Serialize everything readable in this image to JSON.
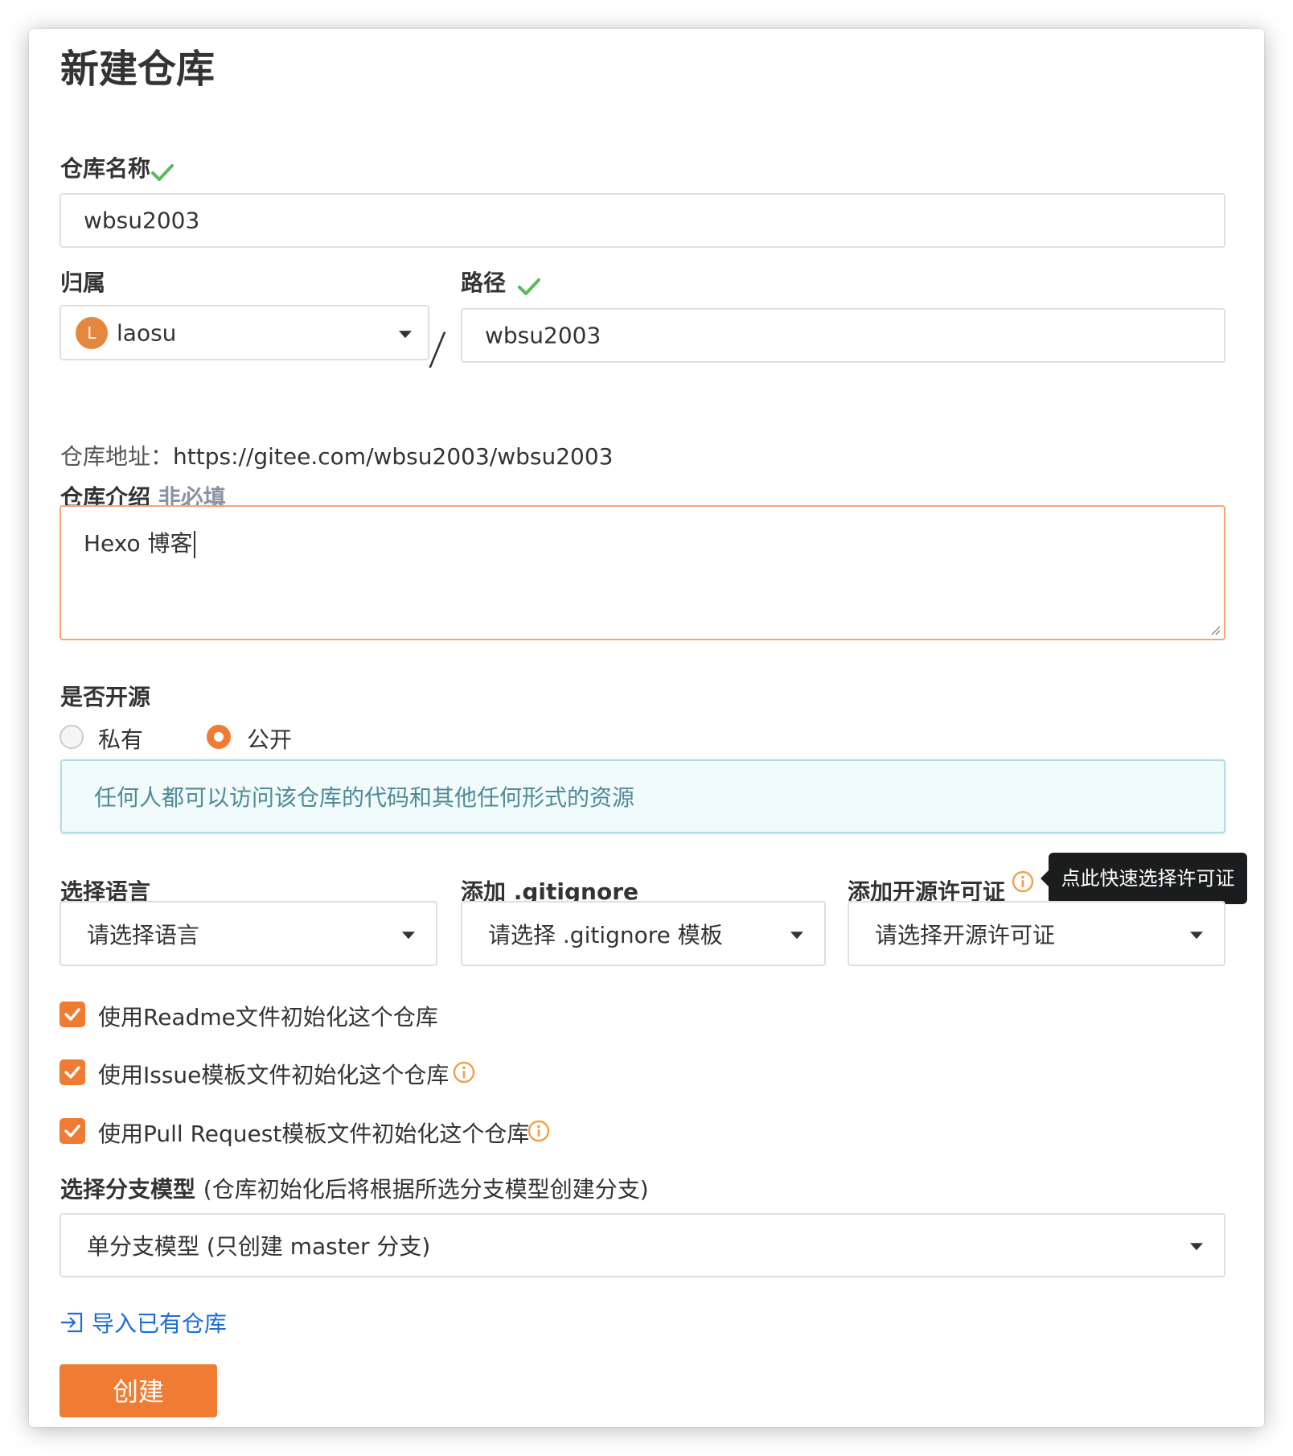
{
  "page": {
    "title": "新建仓库"
  },
  "repo_name": {
    "label": "仓库名称",
    "value": "wbsu2003"
  },
  "owner": {
    "label": "归属",
    "avatar_letter": "L",
    "value": "laosu"
  },
  "path": {
    "label": "路径",
    "value": "wbsu2003"
  },
  "separator": "/",
  "address": {
    "prefix": "仓库地址：",
    "url": "https://gitee.com/wbsu2003/wbsu2003"
  },
  "description": {
    "label": "仓库介绍",
    "optional_hint": "非必填",
    "value": "Hexo 博客"
  },
  "visibility": {
    "label": "是否开源",
    "options": [
      "私有",
      "公开"
    ],
    "selected": "公开",
    "notice": "任何人都可以访问该仓库的代码和其他任何形式的资源"
  },
  "language": {
    "label": "选择语言",
    "placeholder": "请选择语言"
  },
  "gitignore": {
    "label": "添加 .gitignore",
    "placeholder": "请选择 .gitignore 模板"
  },
  "license": {
    "label": "添加开源许可证",
    "placeholder": "请选择开源许可证",
    "tooltip": "点此快速选择许可证"
  },
  "init_options": [
    {
      "label": "使用Readme文件初始化这个仓库",
      "checked": true
    },
    {
      "label": "使用Issue模板文件初始化这个仓库",
      "checked": true
    },
    {
      "label": "使用Pull Request模板文件初始化这个仓库",
      "checked": true
    }
  ],
  "branch_model": {
    "label": "选择分支模型",
    "hint": "(仓库初始化后将根据所选分支模型创建分支)",
    "value": "单分支模型 (只创建 master 分支)"
  },
  "import_link": "导入已有仓库",
  "submit_label": "创建",
  "colors": {
    "accent": "#f07c34",
    "success": "#5cb85c",
    "link": "#1d6ed4",
    "notice_text": "#4f8a99"
  }
}
